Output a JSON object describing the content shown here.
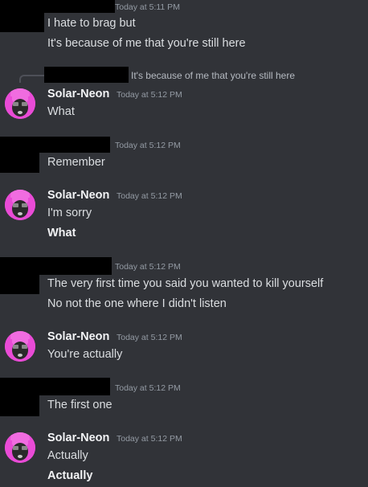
{
  "messages": [
    {
      "timestamp": "Today at 5:11 PM",
      "lines": [
        "I hate to brag but",
        "It's because of me that you're still here"
      ]
    },
    {
      "reply_preview": "It's because of me that you're still here",
      "author": "Solar-Neon",
      "timestamp": "Today at 5:12 PM",
      "lines": [
        "What"
      ]
    },
    {
      "timestamp": "Today at 5:12 PM",
      "lines": [
        "Remember"
      ]
    },
    {
      "author": "Solar-Neon",
      "timestamp": "Today at 5:12 PM",
      "lines": [
        "I'm sorry",
        "What"
      ]
    },
    {
      "timestamp": "Today at 5:12 PM",
      "lines": [
        "The very first time you said you wanted to kill yourself",
        "No not the one where I didn't listen"
      ]
    },
    {
      "author": "Solar-Neon",
      "timestamp": "Today at 5:12 PM",
      "lines": [
        "You're actually"
      ]
    },
    {
      "timestamp": "Today at 5:12 PM",
      "lines": [
        "The first one"
      ]
    },
    {
      "author": "Solar-Neon",
      "timestamp": "Today at 5:12 PM",
      "lines": [
        "Actually",
        "Actually"
      ]
    }
  ],
  "colors": {
    "background": "#313338",
    "text": "#dbdee1",
    "timestamp": "#949ba4",
    "avatar_hair": "#e94bd6",
    "redaction": "#000000"
  },
  "icons": {
    "avatar": "solar-neon-avatar"
  }
}
